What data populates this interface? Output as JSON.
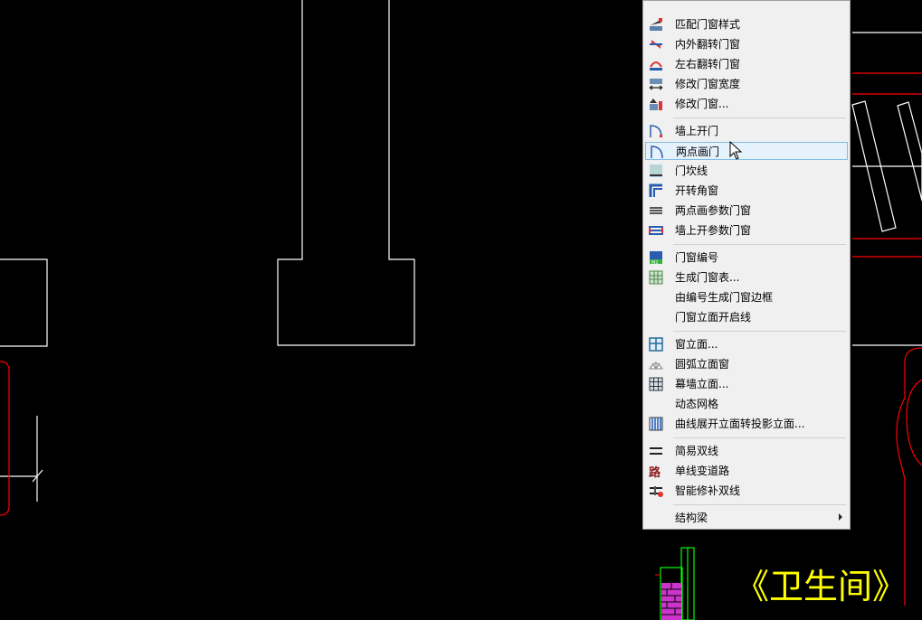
{
  "menu": {
    "items": [
      {
        "label": "匹配门窗样式",
        "icon": "match-style-icon"
      },
      {
        "label": "内外翻转门窗",
        "icon": "flip-inout-icon"
      },
      {
        "label": "左右翻转门窗",
        "icon": "flip-lr-icon"
      },
      {
        "label": "修改门窗宽度",
        "icon": "width-icon"
      },
      {
        "label": "修改门窗...",
        "icon": "modify-icon"
      },
      {
        "label": "墙上开门",
        "icon": "door-wall-icon"
      },
      {
        "label": "两点画门",
        "icon": "door-two-point-icon"
      },
      {
        "label": "门坎线",
        "icon": "sill-icon"
      },
      {
        "label": "开转角窗",
        "icon": "corner-window-icon"
      },
      {
        "label": "两点画参数门窗",
        "icon": "param-window-icon"
      },
      {
        "label": "墙上开参数门窗",
        "icon": "param-wall-icon"
      },
      {
        "label": "门窗编号",
        "icon": "number-icon"
      },
      {
        "label": "生成门窗表...",
        "icon": "table-icon"
      },
      {
        "label": "由编号生成门窗边框",
        "icon": ""
      },
      {
        "label": "门窗立面开启线",
        "icon": ""
      },
      {
        "label": "窗立面...",
        "icon": "window-elevation-icon"
      },
      {
        "label": "圆弧立面窗",
        "icon": "arc-window-icon"
      },
      {
        "label": "幕墙立面...",
        "icon": "curtain-wall-icon"
      },
      {
        "label": "动态网格",
        "icon": ""
      },
      {
        "label": "曲线展开立面转投影立面...",
        "icon": "curve-unfold-icon"
      },
      {
        "label": "简易双线",
        "icon": "double-line-icon"
      },
      {
        "label": "单线变道路",
        "icon": "road-icon"
      },
      {
        "label": "智能修补双线",
        "icon": "repair-icon"
      },
      {
        "label": "结构梁",
        "icon": ""
      }
    ],
    "highlighted": "两点画门"
  },
  "drawing": {
    "title": "《卫生间》",
    "title_color": "#ffff00",
    "line_color": "#ffffff",
    "accent_color": "#ff0000"
  }
}
